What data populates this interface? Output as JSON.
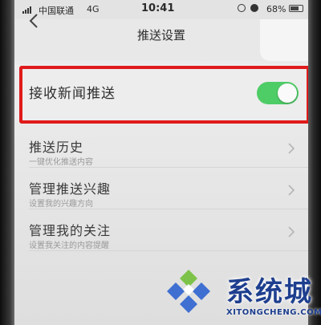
{
  "status_bar": {
    "carrier": "中国联通",
    "network": "4G",
    "time": "10:41",
    "battery": "68%"
  },
  "nav": {
    "title": "推送设置",
    "back_icon": "chevron-left-icon"
  },
  "news_push": {
    "label": "接收新闻推送",
    "enabled": true,
    "toggle_color": "#4ecc66",
    "highlight_color": "#e01b1b"
  },
  "list": [
    {
      "title": "推送历史",
      "subtitle": "一键优化推送内容"
    },
    {
      "title": "管理推送兴趣",
      "subtitle": "设置我的兴趣方向"
    },
    {
      "title": "管理我的关注",
      "subtitle": "设置我关注的内容提醒"
    }
  ],
  "watermark": {
    "name": "系统城",
    "domain": "XITONGCHENG.COM"
  }
}
